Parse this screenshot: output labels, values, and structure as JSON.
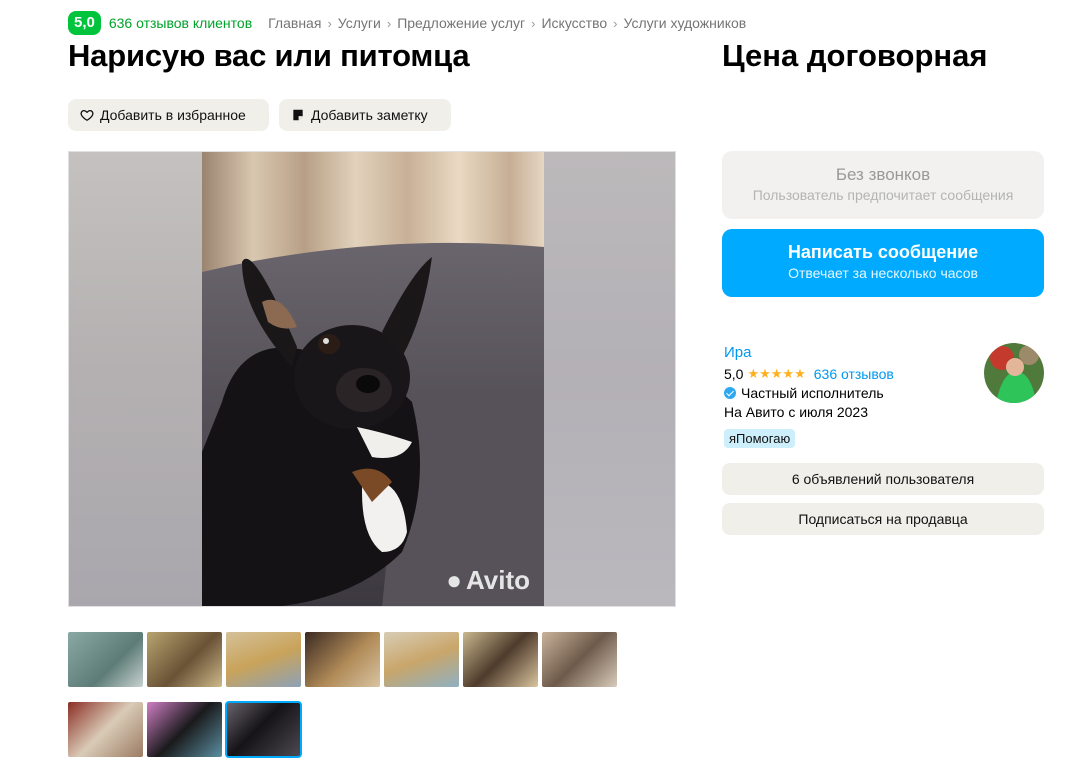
{
  "header": {
    "rating": "5,0",
    "reviews_label": "636 отзывов клиентов",
    "breadcrumbs": [
      "Главная",
      "Услуги",
      "Предложение услуг",
      "Искусство",
      "Услуги художников"
    ]
  },
  "listing": {
    "title": "Нарисую вас или питомца",
    "price": "Цена договорная"
  },
  "actions": {
    "favorite_label": "Добавить в избранное",
    "note_label": "Добавить заметку"
  },
  "gallery": {
    "watermark": "Avito",
    "thumbnails": [
      "photo-1",
      "photo-2",
      "photo-3",
      "photo-4",
      "photo-5",
      "photo-6",
      "photo-7",
      "photo-8",
      "photo-9",
      "photo-10"
    ],
    "active_index": 9
  },
  "contact": {
    "no_calls_title": "Без звонков",
    "no_calls_subtitle": "Пользователь предпочитает сообщения",
    "message_title": "Написать сообщение",
    "message_subtitle": "Отвечает за несколько часов"
  },
  "seller": {
    "name": "Ира",
    "rating": "5,0",
    "stars": "★★★★★",
    "reviews": "636 отзывов",
    "type": "Частный исполнитель",
    "since": "На Авито с июля 2023",
    "badge": "яПомогаю",
    "ads_button": "6 объявлений пользователя",
    "subscribe_button": "Подписаться на продавца"
  },
  "colors": {
    "accent_blue": "#00aaff",
    "rating_green": "#00c43b",
    "star": "#ffb021"
  }
}
